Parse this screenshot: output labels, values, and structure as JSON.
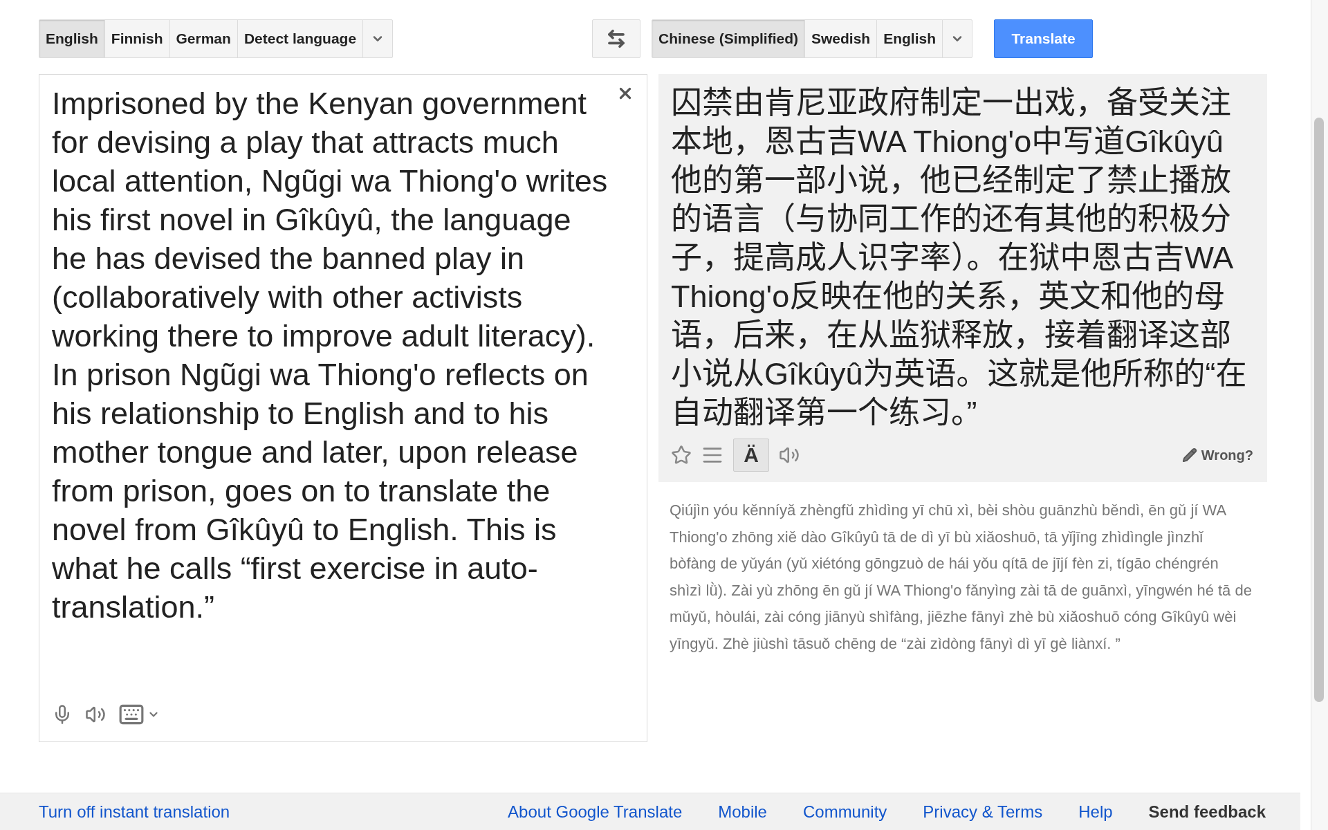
{
  "source_languages": [
    {
      "label": "English",
      "selected": true
    },
    {
      "label": "Finnish",
      "selected": false
    },
    {
      "label": "German",
      "selected": false
    },
    {
      "label": "Detect language",
      "selected": false
    }
  ],
  "target_languages": [
    {
      "label": "Chinese (Simplified)",
      "selected": true
    },
    {
      "label": "Swedish",
      "selected": false
    },
    {
      "label": "English",
      "selected": false
    }
  ],
  "translate_button": "Translate",
  "source": {
    "value": "Imprisoned by the Kenyan government for devising a play that attracts much local attention, Ngũgi wa Thiong'o writes his first novel in Gîkûyû, the language he has devised the banned play in (collaboratively with other activists working there to improve adult literacy). In prison Ngũgi wa Thiong'o reflects on his relationship to English and to his mother tongue and later, upon release from prison, goes on to translate the novel from Gîkûyû to English. This is what he calls “first exercise in auto-translation.”"
  },
  "result": {
    "text": "囚禁由肯尼亚政府制定一出戏，备受关注本地，恩古吉WA Thiong'o中写道Gîkûyû他的第一部小说，他已经制定了禁止播放的语言（与协同工作的还有其他的积极分子，提高成人识字率）。在狱中恩古吉WA Thiong'o反映在他的关系，英文和他的母语，后来，在从监狱释放，接着翻译这部小说从Gîkûyû为英语。这就是他所称的“在自动翻译第一个练习。”",
    "phonetic_toggle": {
      "label": "Ä",
      "selected": true
    },
    "wrong_link": "Wrong?"
  },
  "romanization": "Qiújìn yóu kěnníyǎ zhèngfǔ zhìdìng yī chū xì, bèi shòu guānzhù běndì, ēn gǔ jí WA Thiong'o zhōng xiě dào Gîkûyû tā de dì yī bù xiǎoshuō, tā yǐjīng zhìdìngle jìnzhǐ bòfàng de yǔyán (yǔ xiétóng gōngzuò de hái yǒu qítā de jījí fèn zi, tígāo chéngrén shìzì lǜ). Zài yù zhōng ēn gǔ jí WA Thiong'o fǎnyìng zài tā de guānxì, yīngwén hé tā de mǔyǔ, hòulái, zài cóng jiānyù shìfàng, jiēzhe fānyì zhè bù xiǎoshuō cóng Gîkûyû wèi yīngyǔ. Zhè jiùshì tāsuǒ chēng de “zài zìdòng fānyì dì yī gè liànxí. ”",
  "footer": {
    "instant_link": "Turn off instant translation",
    "links": [
      "About Google Translate",
      "Mobile",
      "Community",
      "Privacy & Terms",
      "Help"
    ],
    "feedback": "Send feedback"
  }
}
